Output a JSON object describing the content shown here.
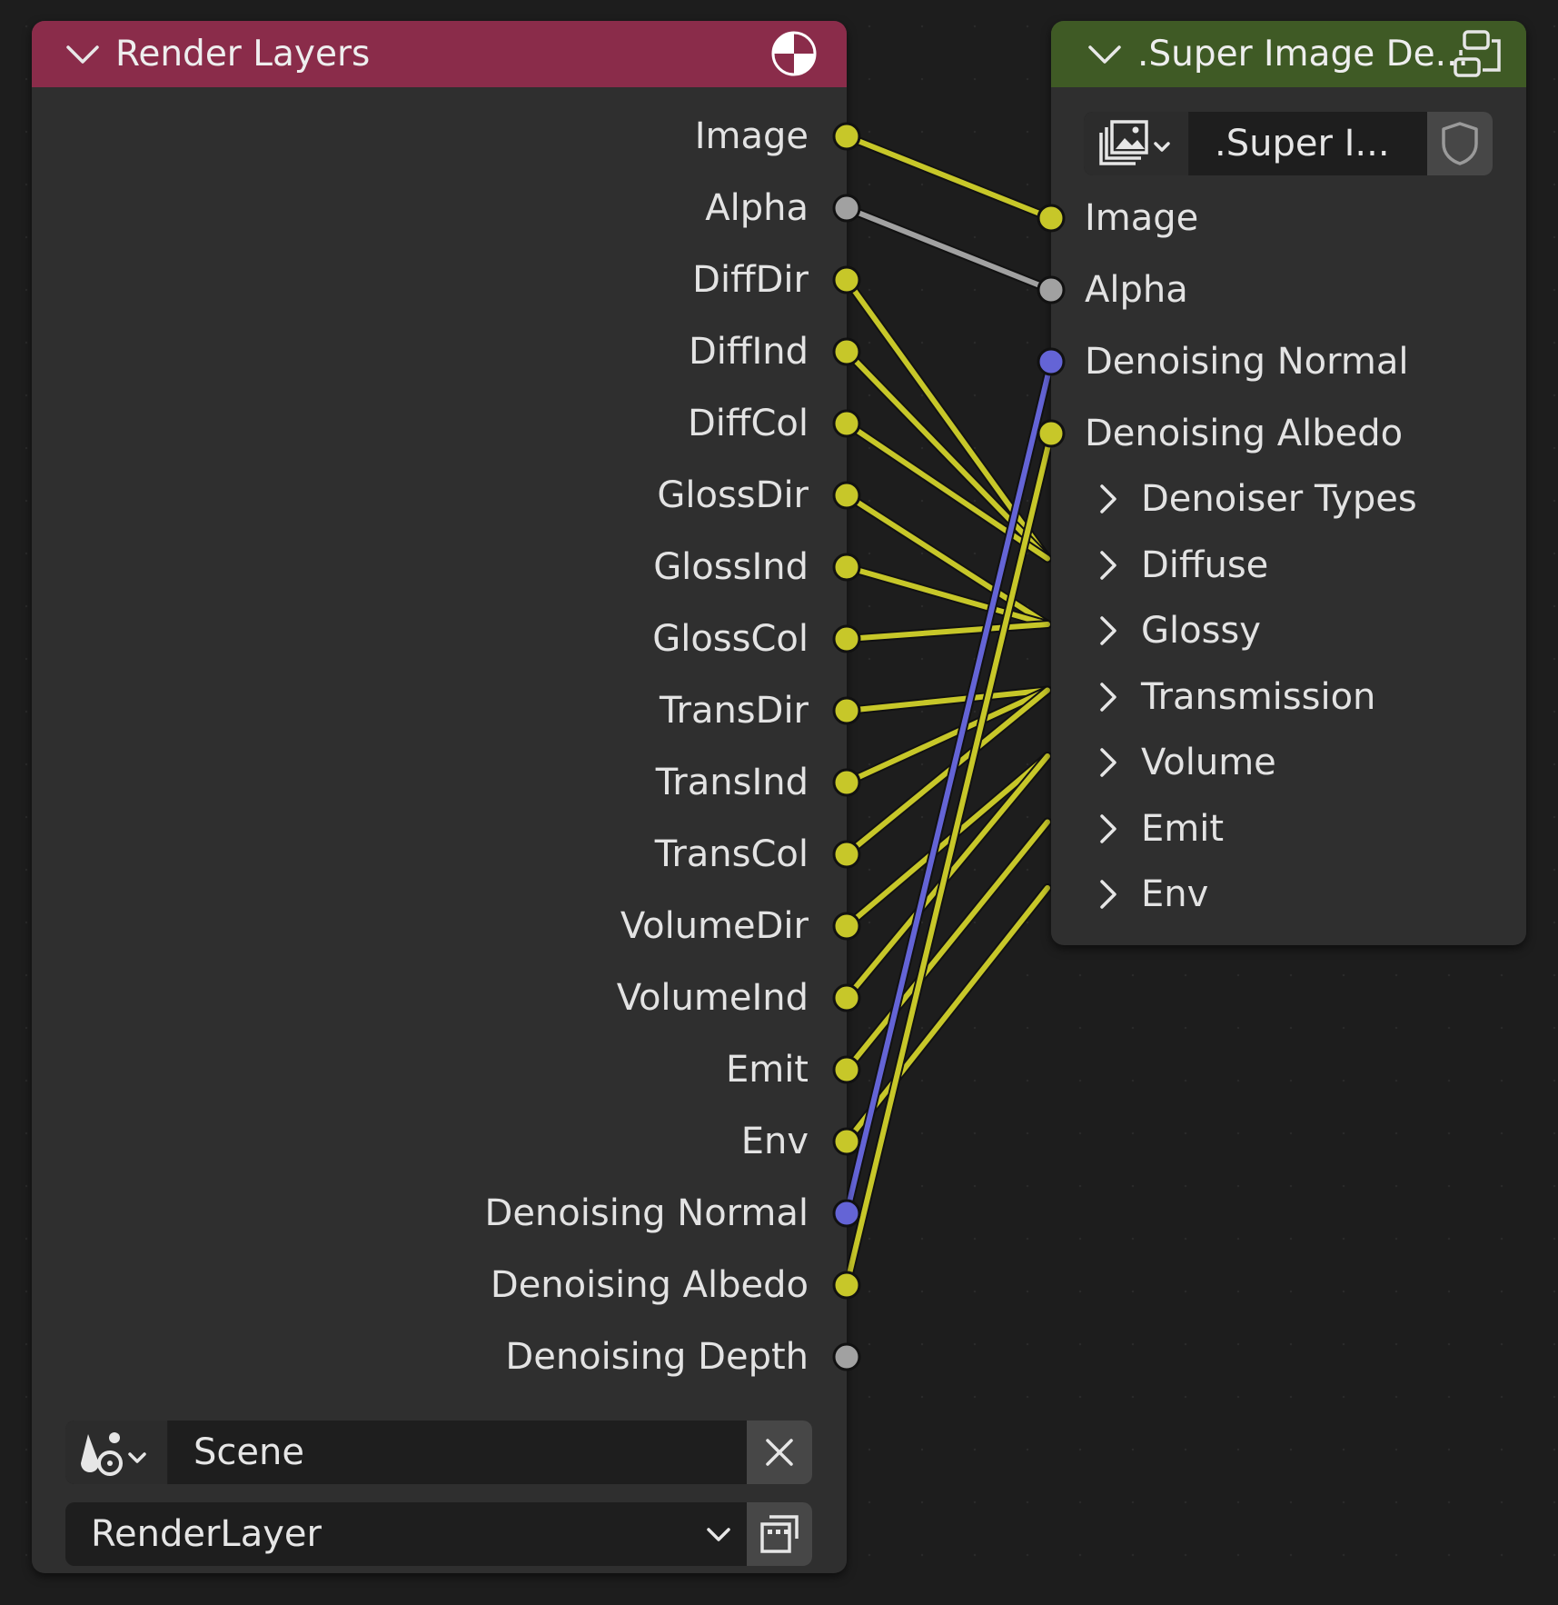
{
  "colors": {
    "render_layers_header": "#8a2c4a",
    "super_image_header": "#3f5a25",
    "color_socket": "#c7c729",
    "float_socket": "#a1a1a1",
    "vector_socket": "#6464d6"
  },
  "render_layers": {
    "title": "Render Layers",
    "header_icon": "render-result-icon",
    "outputs": [
      {
        "label": "Image",
        "type": "color"
      },
      {
        "label": "Alpha",
        "type": "float"
      },
      {
        "label": "DiffDir",
        "type": "color"
      },
      {
        "label": "DiffInd",
        "type": "color"
      },
      {
        "label": "DiffCol",
        "type": "color"
      },
      {
        "label": "GlossDir",
        "type": "color"
      },
      {
        "label": "GlossInd",
        "type": "color"
      },
      {
        "label": "GlossCol",
        "type": "color"
      },
      {
        "label": "TransDir",
        "type": "color"
      },
      {
        "label": "TransInd",
        "type": "color"
      },
      {
        "label": "TransCol",
        "type": "color"
      },
      {
        "label": "VolumeDir",
        "type": "color"
      },
      {
        "label": "VolumeInd",
        "type": "color"
      },
      {
        "label": "Emit",
        "type": "color"
      },
      {
        "label": "Env",
        "type": "color"
      },
      {
        "label": "Denoising Normal",
        "type": "vector"
      },
      {
        "label": "Denoising Albedo",
        "type": "color"
      },
      {
        "label": "Denoising Depth",
        "type": "float"
      }
    ],
    "scene_field": {
      "value": "Scene",
      "icon": "scene-icon",
      "clear_icon": "close-icon"
    },
    "layer_field": {
      "value": "RenderLayer",
      "icon": "render-layer-icon"
    }
  },
  "super_image": {
    "title": ".Super Image De...",
    "header_icon": "node-group-icon",
    "datablock": {
      "value": ".Super I...",
      "icon": "image-icon",
      "fake_user_icon": "shield-icon"
    },
    "inputs": [
      {
        "label": "Image",
        "type": "color"
      },
      {
        "label": "Alpha",
        "type": "float"
      },
      {
        "label": "Denoising Normal",
        "type": "vector"
      },
      {
        "label": "Denoising Albedo",
        "type": "color"
      }
    ],
    "panels": [
      "Denoiser Types",
      "Diffuse",
      "Glossy",
      "Transmission",
      "Volume",
      "Emit",
      "Env"
    ]
  }
}
